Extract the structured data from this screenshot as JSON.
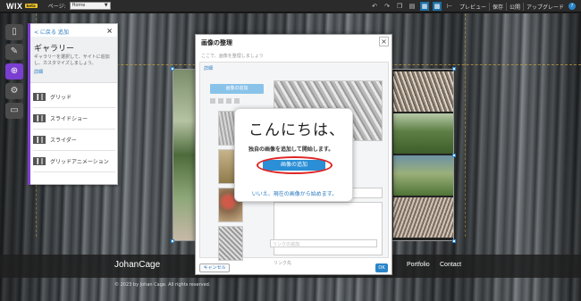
{
  "topbar": {
    "logo": "WIX",
    "logo_badge": "beta",
    "page_label": "ページ:",
    "page_value": "Home",
    "preview": "プレビュー",
    "save": "保存",
    "publish": "公開",
    "upgrade": "アップグレード",
    "help": "?"
  },
  "left_tools": [
    "page-icon",
    "design-icon",
    "add-icon",
    "settings-icon",
    "app-market-icon"
  ],
  "add_panel": {
    "back": "< に戻る 追加",
    "title": "ギャラリー",
    "desc": "ギャラリーを選択して、サイトに追加し、カスタマイズしましょう。",
    "more": "詳細",
    "items": [
      {
        "label": "グリッド"
      },
      {
        "label": "スライドショー"
      },
      {
        "label": "スライダー"
      },
      {
        "label": "グリッドアニメーション"
      }
    ]
  },
  "dialog": {
    "title": "画像の整理",
    "subtitle": "ここで、画像を整理しましょう",
    "hint": "詳細",
    "add_images": "画像の追加",
    "link_label": "リンク先",
    "link_placeholder": "リンクの追加",
    "cancel": "キャンセル",
    "ok": "OK"
  },
  "welcome": {
    "title": "こんにちは、",
    "subtitle": "独自の画像を追加して開始します。",
    "add_button": "画像の追加",
    "skip_link": "いいえ、現在の画像から始めます。"
  },
  "site": {
    "name": "JohanCage",
    "nav": [
      "Portfolio",
      "Contact"
    ],
    "copyright": "© 2023 by Johan Cage. All rights reserved."
  },
  "colors": {
    "accent_purple": "#7a3fd0",
    "primary_blue": "#2a8fd6",
    "highlight_red": "#e02525"
  }
}
